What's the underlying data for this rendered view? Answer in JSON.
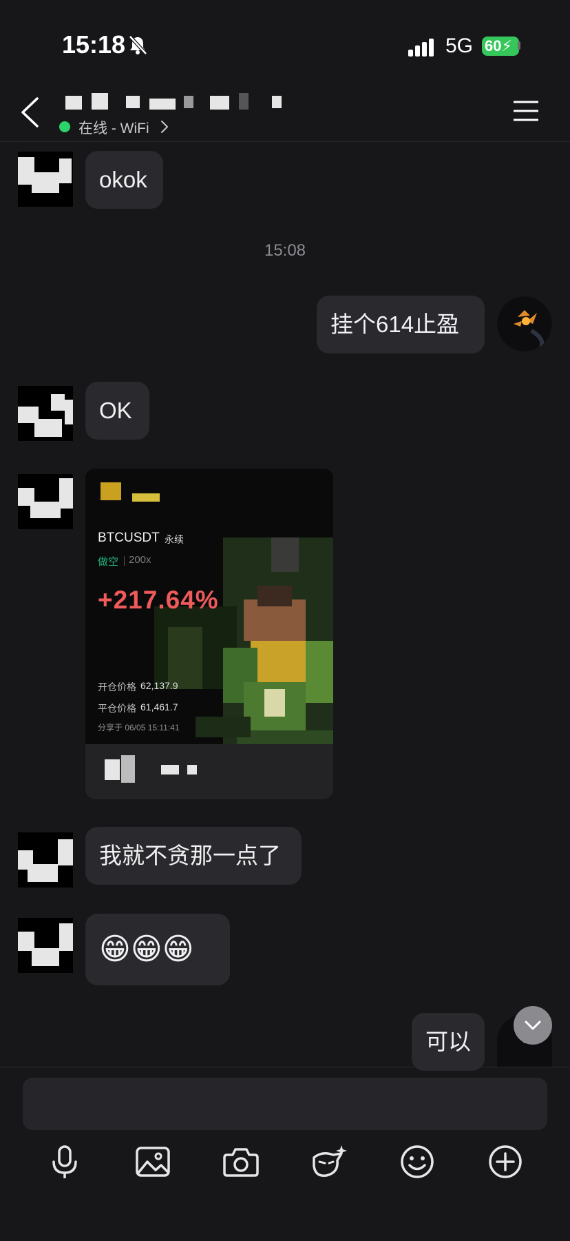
{
  "status_bar": {
    "time": "15:18",
    "network": "5G",
    "battery": "60"
  },
  "header": {
    "status_text": "在线 - WiFi"
  },
  "messages": [
    {
      "from": "them",
      "text": "okok"
    },
    {
      "type": "time",
      "text": "15:08"
    },
    {
      "from": "me",
      "text": "挂个614止盈"
    },
    {
      "from": "them",
      "text": "OK"
    },
    {
      "from": "them",
      "type": "share_card"
    },
    {
      "from": "them",
      "text": "我就不贪那一点了"
    },
    {
      "from": "them",
      "text": "😁😁😁"
    },
    {
      "from": "me",
      "text": "可以"
    }
  ],
  "share_card": {
    "pair": "BTCUSDT",
    "contract_type": "永续",
    "side": "做空",
    "leverage": "200x",
    "pnl_percent": "+217.64%",
    "open_price_label": "开仓价格",
    "open_price": "62,137.9",
    "close_price_label": "平仓价格",
    "close_price": "61,461.7",
    "shared_at": "分享于 06/05 15:11:41"
  },
  "toolbar": {
    "icons": [
      "microphone-icon",
      "image-icon",
      "camera-icon",
      "sticker-icon",
      "emoji-icon",
      "plus-icon"
    ]
  },
  "colors": {
    "background": "#17171a",
    "bubble": "#2a2a2e",
    "online": "#2bd36a",
    "pnl": "#ef5a5a",
    "short": "#22b37a"
  }
}
